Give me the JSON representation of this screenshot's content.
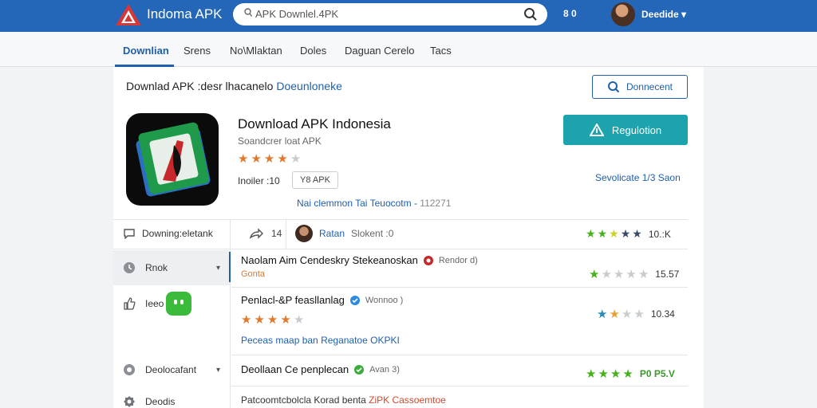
{
  "header": {
    "brand": "Indoma APK",
    "search_query": "APK Downlel.4PK",
    "stat": "8 0",
    "username": "Deedide"
  },
  "nav": {
    "tabs": [
      "Downlian",
      "Srens",
      "No\\Mlaktan",
      "Doles",
      "Daguan Cerelo",
      "Tacs"
    ]
  },
  "breadcrumb": {
    "text": "Downlad APK :desr lhacanelo",
    "link": "Doeunloneke"
  },
  "connect_button": "Donnecent",
  "app": {
    "title": "Download APK Indonesia",
    "subtitle": "Soandcrer loat APK",
    "rating_stars": 4,
    "meta_label": "Inoiler :10",
    "meta_chip": "Y8 APK",
    "update_text": "Nai clemmon Tai Teuocotm -",
    "update_num": "112271",
    "download_button": "Regulotion",
    "size_note": "Sevolicate 1/3 Saon"
  },
  "stats": {
    "left_label": "Downing:eletank",
    "shares": "14",
    "author_name": "Ratan",
    "author_rest": "Slokent :0",
    "rating_value": "10.:K"
  },
  "sidebar": {
    "items": [
      "Rnok",
      "Ieeo",
      "Deolocafant",
      "Deodis"
    ]
  },
  "reviews": [
    {
      "title": "Naolam Aim Cendeskry Stekeanoskan",
      "tag": "Rendor d)",
      "sub": "Gonta",
      "value": "15.57"
    },
    {
      "title": "Penlacl-&P feasllanlag",
      "tag": "Wonnoo )",
      "link": "Peceas maap ban Reganatoe OKPKI",
      "value": "10.34"
    },
    {
      "title": "Deollaan Ce penplecan",
      "tag": "Avan 3)",
      "value": "P0 P5.V"
    },
    {
      "link": "Patcoomtcbolcla Korad benta",
      "accent": "ZiPK Cassoemtoe"
    }
  ],
  "colors": {
    "header_bg": "#2466b8",
    "accent_blue": "#1f5fad",
    "download_teal": "#1ca3ad",
    "star_orange": "#e0792b",
    "star_green": "#47b01c"
  },
  "icons": [
    "logo-icon",
    "search-icon",
    "connect-search-icon",
    "download-icon",
    "comment-icon",
    "share-icon",
    "chevron-down-icon",
    "clock-icon",
    "like-icon",
    "gear-icon",
    "verified-icon",
    "check-icon"
  ]
}
